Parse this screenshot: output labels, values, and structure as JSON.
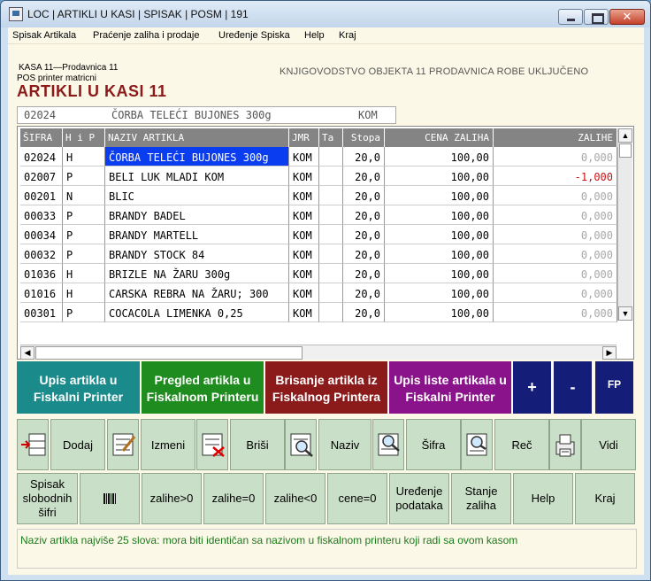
{
  "window": {
    "title": "LOC | ARTIKLI U KASI | SPISAK | POSM | 191"
  },
  "menu": [
    "Spisak Artikala",
    "Praćenje zaliha i prodaje",
    "Uređenje Spiska",
    "Help",
    "Kraj"
  ],
  "header": {
    "kasa": "KASA 11—Prodavnica 11",
    "pos": "POS printer matricni",
    "right": "KNJIGOVODSTVO OBJEKTA 11 PRODAVNICA ROBE UKLJUČENO",
    "title": "ARTIKLI U KASI 11"
  },
  "current": {
    "sifra": "02024",
    "naziv": "ČORBA TELEĆI BUJONES 300g",
    "jmr": "KOM"
  },
  "table": {
    "columns": [
      "ŠIFRA",
      "H i P",
      "NAZIV ARTIKLA",
      "JMR",
      "Ta",
      "Stopa",
      "CENA ZALIHA",
      "ZALIHE"
    ],
    "rows": [
      {
        "sifra": "02024",
        "hp": "H",
        "naziv": "ČORBA TELEĆI BUJONES 300g",
        "jmr": "KOM",
        "ta": "",
        "stopa": "20,0",
        "cena": "100,00",
        "zalihe": "0,000"
      },
      {
        "sifra": "02007",
        "hp": "P",
        "naziv": "BELI LUK MLADI KOM",
        "jmr": "KOM",
        "ta": "",
        "stopa": "20,0",
        "cena": "100,00",
        "zalihe": "-1,000"
      },
      {
        "sifra": "00201",
        "hp": "N",
        "naziv": "BLIC",
        "jmr": "KOM",
        "ta": "",
        "stopa": "20,0",
        "cena": "100,00",
        "zalihe": "0,000"
      },
      {
        "sifra": "00033",
        "hp": "P",
        "naziv": "BRANDY BADEL",
        "jmr": "KOM",
        "ta": "",
        "stopa": "20,0",
        "cena": "100,00",
        "zalihe": "0,000"
      },
      {
        "sifra": "00034",
        "hp": "P",
        "naziv": "BRANDY MARTELL",
        "jmr": "KOM",
        "ta": "",
        "stopa": "20,0",
        "cena": "100,00",
        "zalihe": "0,000"
      },
      {
        "sifra": "00032",
        "hp": "P",
        "naziv": "BRANDY STOCK 84",
        "jmr": "KOM",
        "ta": "",
        "stopa": "20,0",
        "cena": "100,00",
        "zalihe": "0,000"
      },
      {
        "sifra": "01036",
        "hp": "H",
        "naziv": "BRIZLE NA ŽARU 300g",
        "jmr": "KOM",
        "ta": "",
        "stopa": "20,0",
        "cena": "100,00",
        "zalihe": "0,000"
      },
      {
        "sifra": "01016",
        "hp": "H",
        "naziv": "CARSKA REBRA NA ŽARU; 300",
        "jmr": "KOM",
        "ta": "",
        "stopa": "20,0",
        "cena": "100,00",
        "zalihe": "0,000"
      },
      {
        "sifra": "00301",
        "hp": "P",
        "naziv": "COCACOLA LIMENKA 0,25",
        "jmr": "KOM",
        "ta": "",
        "stopa": "20,0",
        "cena": "100,00",
        "zalihe": "0,000"
      }
    ]
  },
  "actions": {
    "upis": "Upis artikla u Fiskalni Printer",
    "pregled": "Pregled artikla u Fiskalnom Printeru",
    "brisanje": "Brisanje artikla iz Fiskalnog Printera",
    "lista": "Upis liste artikala u Fiskalni Printer",
    "plus": "+",
    "minus": "-",
    "fp": "FP"
  },
  "toolbar": {
    "dodaj": "Dodaj",
    "izmeni": "Izmeni",
    "brisi": "Briši",
    "naziv": "Naziv",
    "sifra": "Šifra",
    "rec": "Reč",
    "vidi": "Vidi"
  },
  "bottom": {
    "spisak": "Spisak slobodnih šifri",
    "zalihe_gt": "zalihe>0",
    "zalihe_eq": "zalihe=0",
    "zalihe_lt": "zalihe<0",
    "cene": "cene=0",
    "uredjenje": "Uređenje podataka",
    "stanje": "Stanje zaliha",
    "help": "Help",
    "kraj": "Kraj"
  },
  "status": "Naziv artikla najviše 25 slova: mora biti identičan sa nazivom u fiskalnom printeru koji radi sa ovom kasom",
  "colors": {
    "teal": "#1b8a8a",
    "green": "#1e8c1e",
    "maroon": "#8b1a1a",
    "purple": "#8a128a",
    "navy": "#141d78",
    "selection": "#0a3cf0"
  }
}
